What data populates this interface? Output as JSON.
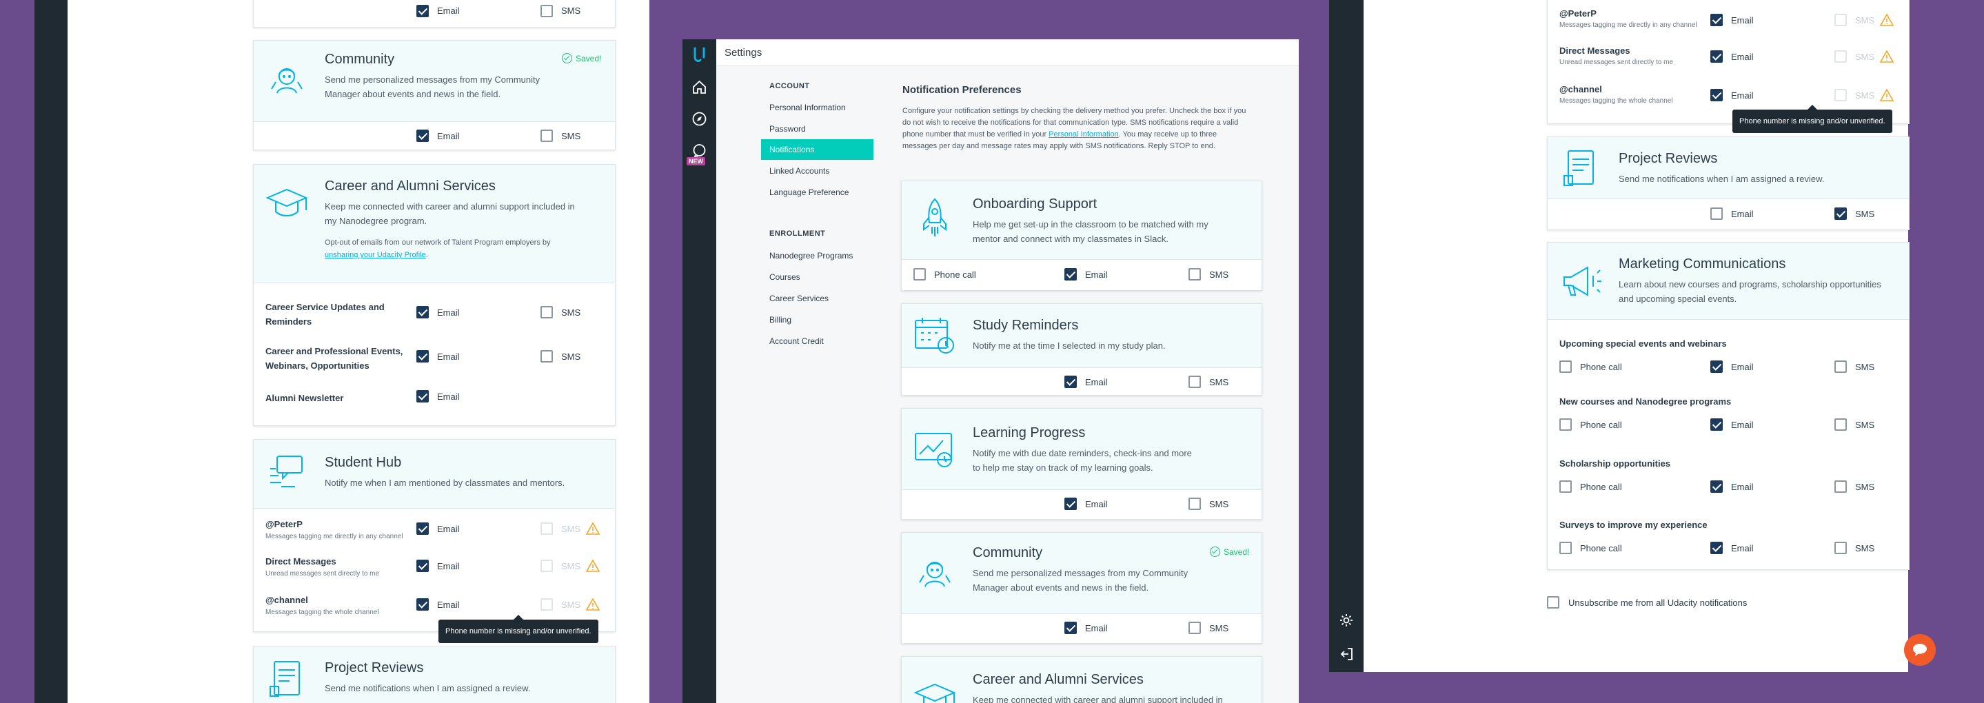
{
  "app": {
    "title": "Settings",
    "new_badge": "NEW"
  },
  "settings_nav": {
    "account_header": "ACCOUNT",
    "account_items": [
      "Personal Information",
      "Password",
      "Notifications",
      "Linked Accounts",
      "Language Preference"
    ],
    "enrollment_header": "ENROLLMENT",
    "enrollment_items": [
      "Nanodegree Programs",
      "Courses",
      "Career Services",
      "Billing",
      "Account Credit"
    ]
  },
  "prefs": {
    "title": "Notification Preferences",
    "intro_1": "Configure your notification settings by checking the delivery method you prefer. Uncheck the box if you",
    "intro_2": "do not wish to receive the notifications for that communication type. SMS notifications require a valid",
    "intro_3a": "phone number that must be verified in your ",
    "intro_link": "Personal Information",
    "intro_3b": ". You may receive up to three",
    "intro_4": "messages per day and message rates may apply with SMS notifications. Reply STOP to end."
  },
  "labels": {
    "email": "Email",
    "sms": "SMS",
    "phone": "Phone call",
    "saved": "Saved!"
  },
  "tooltip": "Phone number is missing and/or unverified.",
  "cards": {
    "onboarding": {
      "title": "Onboarding Support",
      "d1": "Help me get set-up in the classroom to be matched with my",
      "d2": "mentor and connect with my classmates in Slack."
    },
    "study": {
      "title": "Study Reminders",
      "d1": "Notify me at the time I selected in my study plan."
    },
    "learning": {
      "title": "Learning Progress",
      "d1": "Notify me with due date reminders, check-ins and more",
      "d2": "to help me stay on track of my learning goals."
    },
    "community": {
      "title": "Community",
      "d1": "Send me personalized messages from my Community",
      "d2": "Manager about events and news in the field."
    },
    "career": {
      "title": "Career and Alumni Services",
      "d1": "Keep me connected with career and alumni support included in",
      "d2": "my Nanodegree program.",
      "d3": "Opt-out of emails from our network of Talent Program employers by",
      "link": "unsharing your Udacity Profile",
      "dot": "."
    },
    "career_rows": [
      {
        "l1": "Career Service Updates and",
        "l2": "Reminders"
      },
      {
        "l1": "Career and Professional Events,",
        "l2": "Webinars, Opportunities"
      },
      {
        "l1": "Alumni Newsletter"
      }
    ],
    "hub": {
      "title": "Student Hub",
      "d1": "Notify me when I am mentioned by classmates and mentors."
    },
    "hub_rows": [
      {
        "name": "@PeterP",
        "sub": "Messages tagging me directly in any channel"
      },
      {
        "name": "Direct Messages",
        "sub": "Unread messages sent directly to me"
      },
      {
        "name": "@channel",
        "sub": "Messages tagging the whole channel"
      }
    ],
    "reviews": {
      "title": "Project Reviews",
      "d1": "Send me notifications when I am assigned a review."
    },
    "marketing": {
      "title": "Marketing Communications",
      "d1": "Learn about new courses and programs, scholarship opportunities",
      "d2": "and upcoming special events."
    },
    "marketing_rows": [
      "Upcoming special events and webinars",
      "New courses and Nanodegree programs",
      "Scholarship opportunities",
      "Surveys to improve my experience"
    ]
  },
  "unsubscribe": "Unsubscribe me from all Udacity notifications",
  "colors": {
    "accent": "#02ccba",
    "brand": "#02b3e4",
    "sidebar": "#1f2a33",
    "background": "#6a4c8c",
    "saved": "#15c26b",
    "warning": "#f5a623"
  }
}
